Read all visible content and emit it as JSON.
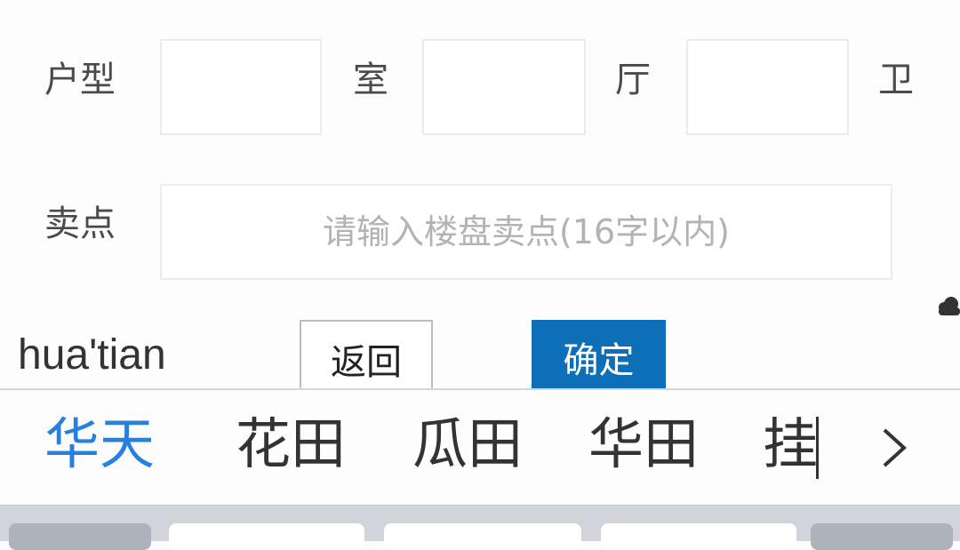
{
  "form": {
    "layout_label": "户型",
    "room_unit": "室",
    "hall_unit": "厅",
    "bath_unit": "卫",
    "room_value": "",
    "hall_value": "",
    "bath_value": "",
    "sellpoint_label": "卖点",
    "sellpoint_value": "",
    "sellpoint_placeholder": "请输入楼盘卖点(16字以内)"
  },
  "ime": {
    "composition": "hua'tian",
    "back_label": "返回",
    "ok_label": "确定",
    "candidates": [
      "华天",
      "花田",
      "瓜田",
      "华田"
    ],
    "partial_candidate": "挂",
    "more_icon": "chevron-right-icon",
    "colors": {
      "active_candidate": "#2680de",
      "ok_button": "#0c6fb8"
    }
  }
}
